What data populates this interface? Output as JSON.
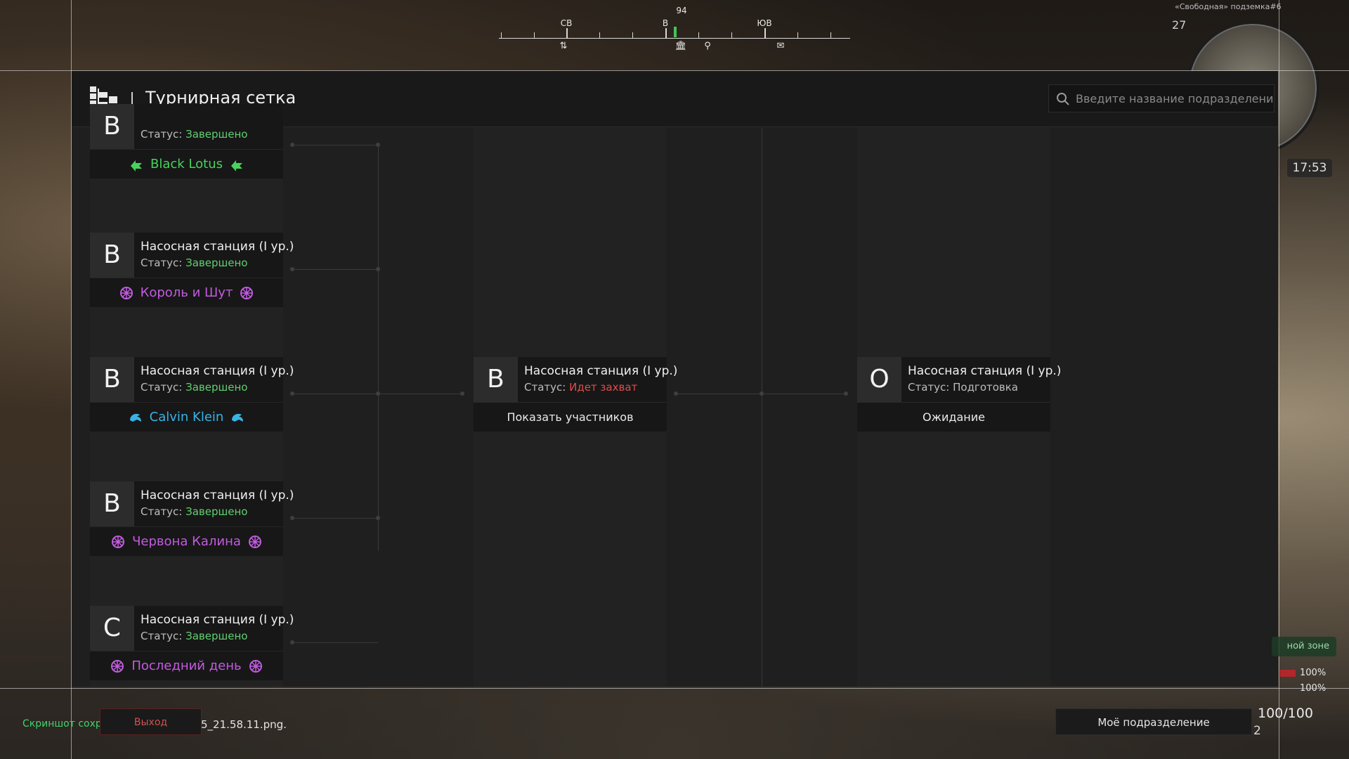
{
  "hud": {
    "compass": {
      "heading": "94",
      "directions": [
        {
          "label": "СВ"
        },
        {
          "label": "В"
        },
        {
          "label": "ЮВ"
        }
      ]
    },
    "minimap": {
      "location": "«Свободная» подземка#6",
      "level": "27",
      "time": "17:53"
    },
    "zone_badge": "ной зоне",
    "stats": [
      "100%",
      "100%"
    ],
    "hp": "100/100",
    "ammo": "2",
    "my_unit_button": "Моё подразделение",
    "exit_button": "Выход",
    "screenshot_text": "Скриншот сохр",
    "screenshot_file": "5_21.58.11.png."
  },
  "header": {
    "title": "Турнирная сетка",
    "search_placeholder": "Введите название подразделения"
  },
  "bracket": {
    "status_prefix": "Статус:",
    "round1": [
      {
        "letter": "B",
        "name": "",
        "status": "Завершено",
        "status_color": "#5fd070",
        "winner": "Black Lotus",
        "winner_color": "#45d45a",
        "clan_icon": "arrow-emblem-icon"
      },
      {
        "letter": "B",
        "name": "Насосная станция (I ур.)",
        "status": "Завершено",
        "status_color": "#5fd070",
        "winner": "Король и Шут",
        "winner_color": "#c25be0",
        "clan_icon": "flower-emblem-icon"
      },
      {
        "letter": "B",
        "name": "Насосная станция (I ур.)",
        "status": "Завершено",
        "status_color": "#5fd070",
        "winner": "Calvin Klein",
        "winner_color": "#39b3e6",
        "clan_icon": "wave-emblem-icon"
      },
      {
        "letter": "B",
        "name": "Насосная станция (I ур.)",
        "status": "Завершено",
        "status_color": "#5fd070",
        "winner": "Червона Калина",
        "winner_color": "#c25be0",
        "clan_icon": "flower-emblem-icon"
      },
      {
        "letter": "C",
        "name": "Насосная станция (I ур.)",
        "status": "Завершено",
        "status_color": "#5fd070",
        "winner": "Последний день",
        "winner_color": "#c25be0",
        "clan_icon": "flower-emblem-icon"
      }
    ],
    "round2": {
      "letter": "B",
      "name": "Насосная станция (I ур.)",
      "status": "Идет захват",
      "status_color": "#e24b4b",
      "action": "Показать участников"
    },
    "round3": {
      "letter": "O",
      "name": "Насосная станция (I ур.)",
      "status": "Подготовка",
      "status_color": "#bdbdbd",
      "action": "Ожидание"
    }
  }
}
